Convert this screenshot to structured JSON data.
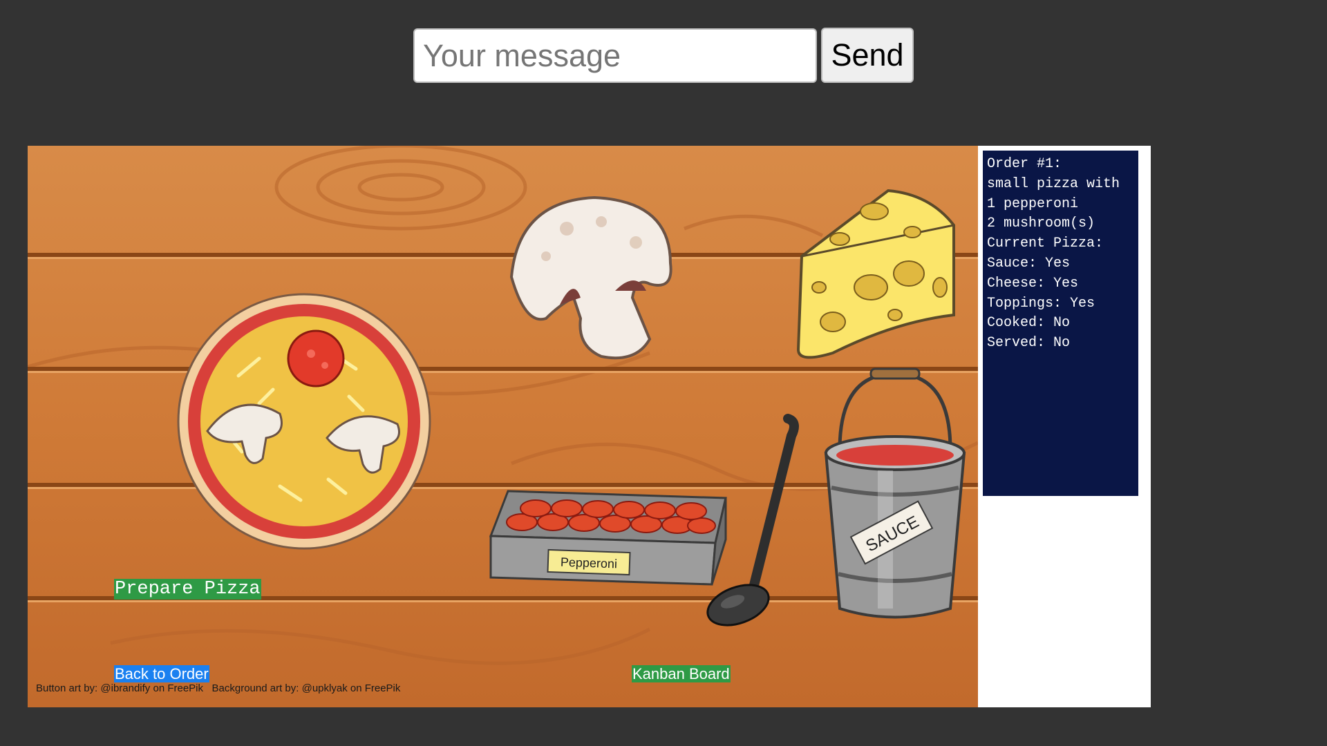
{
  "chat": {
    "placeholder": "Your message",
    "send_label": "Send"
  },
  "game": {
    "buttons": {
      "prepare": "Prepare Pizza",
      "back": "Back to Order",
      "kanban": "Kanban Board"
    },
    "credits": {
      "button_art": "Button art by: @ibrandify on FreePik",
      "background_art": "Background art by: @upklyak on FreePik"
    },
    "labels": {
      "pepperoni_tag": "Pepperoni",
      "sauce_tag": "SAUCE"
    },
    "colors": {
      "background": "#333333",
      "wood": "#d2793a",
      "order_panel": "#0a1646",
      "green_button": "#2e9a45",
      "blue_button": "#1a80f0"
    }
  },
  "order_panel": {
    "lines": [
      "Order #1:",
      "small pizza with",
      "1 pepperoni",
      "2 mushroom(s)",
      "Current Pizza:",
      "Sauce: Yes",
      "Cheese: Yes",
      "Toppings: Yes",
      "Cooked: No",
      "Served: No"
    ]
  }
}
